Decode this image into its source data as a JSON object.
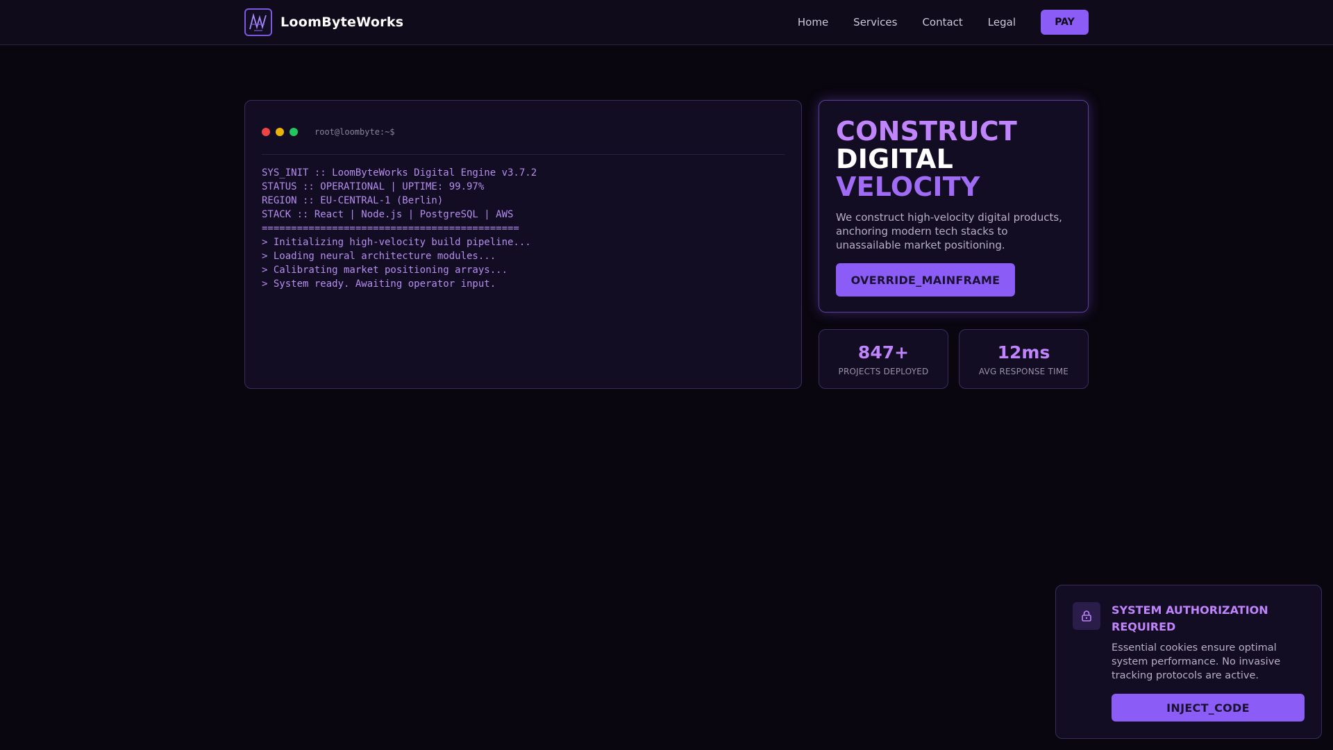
{
  "brand": {
    "name": "LoomByteWorks",
    "logo_icon": "loom-logo-icon"
  },
  "nav": {
    "links": [
      "Home",
      "Services",
      "Contact",
      "Legal"
    ],
    "pay_label": "PAY"
  },
  "terminal": {
    "prompt": "root@loombyte:~$",
    "lines": [
      "SYS_INIT :: LoomByteWorks Digital Engine v3.7.2",
      "STATUS :: OPERATIONAL | UPTIME: 99.97%",
      "REGION :: EU-CENTRAL-1 (Berlin)",
      "STACK :: React | Node.js | PostgreSQL | AWS",
      "============================================",
      "> Initializing high-velocity build pipeline...",
      "> Loading neural architecture modules...",
      "> Calibrating market positioning arrays...",
      "> System ready. Awaiting operator input."
    ]
  },
  "hero": {
    "title_line1": "CONSTRUCT",
    "title_line2": "DIGITAL",
    "title_line3": "VELOCITY",
    "description": "We construct high-velocity digital products, anchoring modern tech stacks to unassailable market positioning.",
    "cta_label": "OVERRIDE_MAINFRAME"
  },
  "stats": [
    {
      "value": "847+",
      "label": "PROJECTS DEPLOYED"
    },
    {
      "value": "12ms",
      "label": "AVG RESPONSE TIME"
    }
  ],
  "cookie": {
    "icon": "lock-icon",
    "title": "SYSTEM AUTHORIZATION REQUIRED",
    "text": "Essential cookies ensure optimal system performance. No invasive tracking protocols are active.",
    "button_label": "INJECT_CODE"
  },
  "colors": {
    "background": "#09060f",
    "accent": "#8b5cf6",
    "accent_light": "#c084fc"
  }
}
